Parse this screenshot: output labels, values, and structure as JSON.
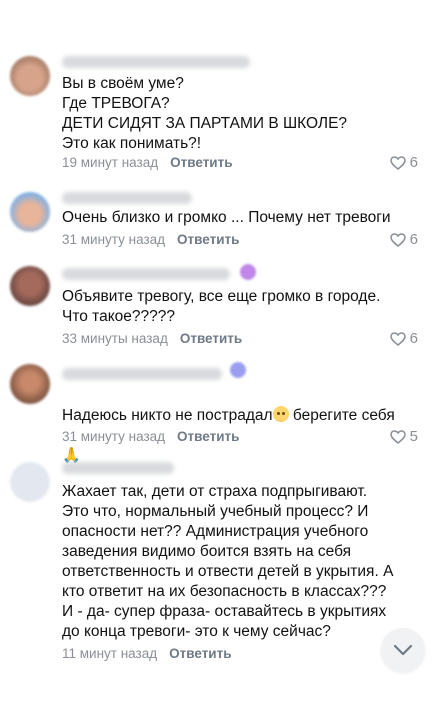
{
  "colors": {
    "meta": "#8a8f96",
    "reply": "#6f7a86",
    "text": "#111111"
  },
  "comments": [
    {
      "text": "Вы в своём уме?\nГде ТРЕВОГА?\nДЕТИ СИДЯТ ЗА ПАРТАМИ В ШКОЛЕ?\nЭто как понимать?!",
      "time": "19 минут назад",
      "reply": "Ответить",
      "likes": "6"
    },
    {
      "text": "Очень близко и громко ... Почему нет тревоги",
      "time": "31 минуту назад",
      "reply": "Ответить",
      "likes": "6"
    },
    {
      "text": "Объявите тревогу, все еще громко в городе.\nЧто такое?????",
      "time": "33 минуты назад",
      "reply": "Ответить",
      "likes": "6"
    },
    {
      "text_before": "Надеюсь никто не пострадал",
      "text_after": " берегите себя",
      "emoji_1": "pleading-face-emoji",
      "emoji_2": "🙏",
      "time": "31 минуту назад",
      "reply": "Ответить",
      "likes": "5"
    },
    {
      "text": "Жахает так, дети от страха подпрыгивают. Это что, нормальный учебный процесс? И опасности нет?? Администрация учебного заведения видимо боится взять на себя ответственность и отвести детей в укрытия. А кто ответит на их безопасность в классах??? И - да- супер фраза- оставайтесь в укрытиях до конца тревоги- это к чему сейчас?",
      "time": "11 минут назад",
      "reply": "Ответить"
    }
  ],
  "icons": {
    "like": "heart-icon",
    "scroll": "chevron-down-icon"
  }
}
